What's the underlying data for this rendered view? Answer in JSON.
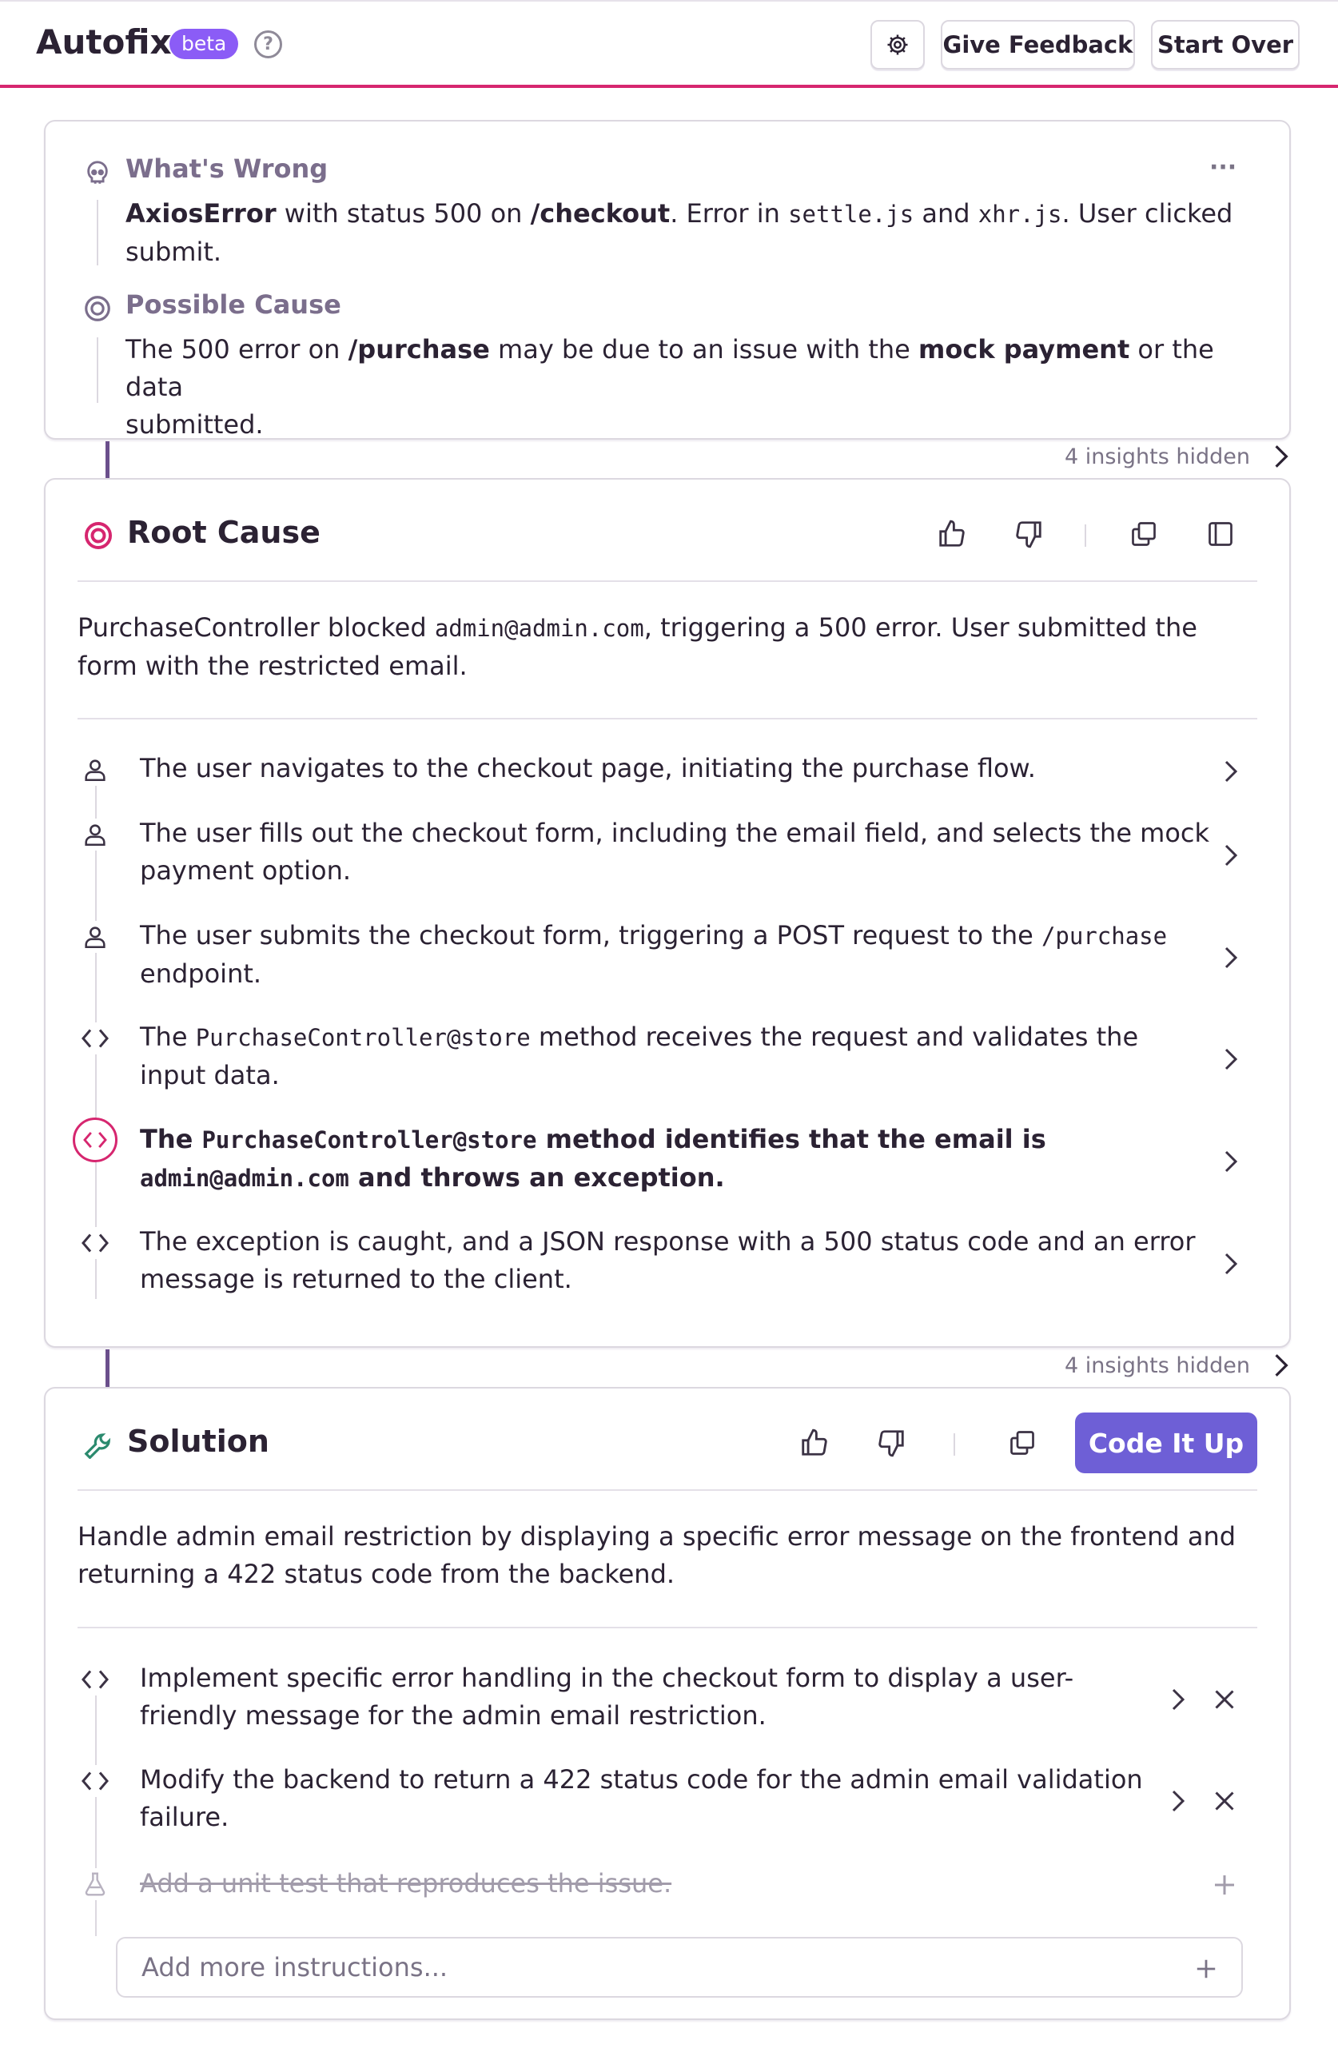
{
  "header": {
    "title": "Autofix",
    "badge": "beta",
    "help_glyph": "?",
    "settings_icon": "gear-icon",
    "feedback_label": "Give Feedback",
    "start_over_label": "Start Over"
  },
  "summary": {
    "menu_glyph": "···",
    "whats_wrong": {
      "label": "What's Wrong",
      "icon": "skull-icon",
      "error_name": "AxiosError",
      "t1": " with status 500 on ",
      "route": "/checkout",
      "t2": ".  Error in ",
      "file1": "settle.js",
      "t3": " and ",
      "file2": "xhr.js",
      "t4": ". User clicked",
      "t5": "submit."
    },
    "possible_cause": {
      "label": "Possible Cause",
      "icon": "target-icon",
      "t1": "The 500 error on ",
      "route": "/purchase",
      "t2": " may be due to an issue with the ",
      "bold": "mock payment",
      "t3": " or the data",
      "t4": "submitted."
    }
  },
  "insights_hidden_1": "4 insights hidden",
  "root_cause": {
    "title": "Root Cause",
    "icon": "target-icon",
    "summary_t1": "PurchaseController blocked ",
    "summary_code": "admin@admin.com",
    "summary_t2": ", triggering a 500 error. User submitted the",
    "summary_t3": "form with the restricted email.",
    "steps": [
      {
        "icon": "user-icon",
        "line1": "The user navigates to the checkout page, initiating the purchase flow."
      },
      {
        "icon": "user-icon",
        "line1": "The user fills out the checkout form, including the email field, and selects the mock",
        "line2": "payment option."
      },
      {
        "icon": "user-icon",
        "line1a": "The user submits the checkout form, triggering a POST request to the ",
        "line1code": "/purchase",
        "line2": "endpoint."
      },
      {
        "icon": "code-icon",
        "line1a": "The ",
        "line1code": "PurchaseController@store",
        "line1b": " method receives the request and validates the",
        "line2": "input data."
      },
      {
        "icon": "code-icon",
        "line1a": "The ",
        "line1code": "PurchaseController@store",
        "line1b": " method identifies that the email is",
        "line2code": "admin@admin.com",
        "line2b": " and throws an exception."
      },
      {
        "icon": "code-icon",
        "line1": "The exception is caught, and a JSON response with a 500 status code and an error",
        "line2": "message is returned to the client."
      }
    ]
  },
  "insights_hidden_2": "4 insights hidden",
  "solution": {
    "title": "Solution",
    "icon": "wrench-icon",
    "code_button": "Code It Up",
    "summary_l1": "Handle admin email restriction by displaying a specific error message on the frontend and",
    "summary_l2": "returning a 422 status code from the backend.",
    "steps": [
      {
        "icon": "code-icon",
        "line1": "Implement specific error handling in the checkout form to display a user-",
        "line2": "friendly message for the admin email restriction."
      },
      {
        "icon": "code-icon",
        "line1": "Modify the backend to return a 422 status code for the admin email validation",
        "line2": "failure."
      }
    ],
    "disabled_step": "Add a unit test that reproduces the issue.",
    "input_placeholder": "Add more instructions..."
  },
  "colors": {
    "accent": "#d6266f",
    "primary": "#6e5fd6",
    "beta": "#8b5cf6",
    "connector": "#6b4f8c",
    "wrench": "#2b8a6e"
  }
}
